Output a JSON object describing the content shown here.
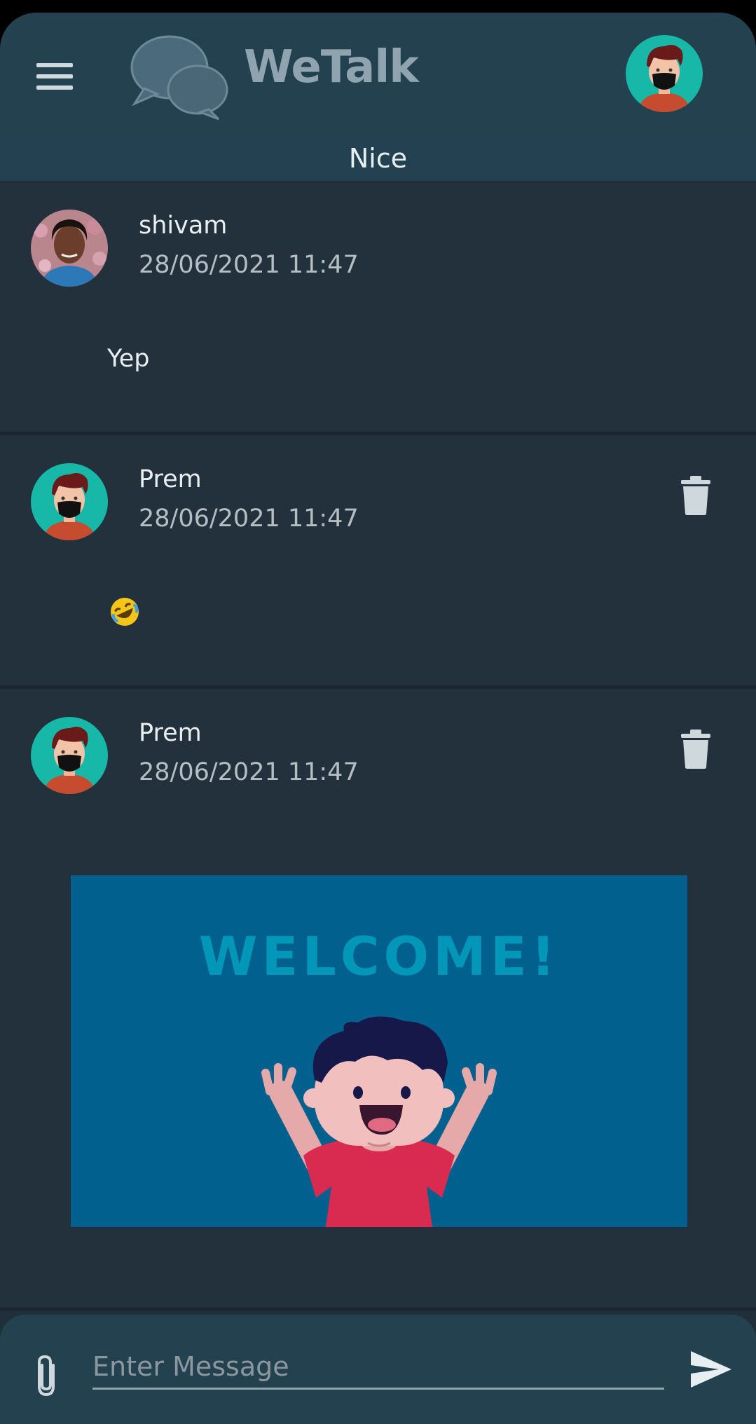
{
  "app": {
    "title": "WeTalk",
    "room_name": "Nice"
  },
  "icons": {
    "menu": "menu-icon",
    "logo": "chat-bubbles-icon",
    "delete": "trash-icon",
    "attach": "paperclip-icon",
    "send": "send-icon"
  },
  "messages": [
    {
      "sender": "shivam",
      "time": "28/06/2021 11:47",
      "text": "Yep",
      "avatar": "photo-avatar",
      "deletable": false
    },
    {
      "sender": "Prem",
      "time": "28/06/2021 11:47",
      "emoji": "laughing-emoji",
      "avatar": "masked-avatar",
      "deletable": true
    },
    {
      "sender": "Prem",
      "time": "28/06/2021 11:47",
      "image_text": "WELCOME!",
      "avatar": "masked-avatar",
      "deletable": true
    }
  ],
  "composer": {
    "placeholder": "Enter Message",
    "value": ""
  },
  "colors": {
    "appbar": "#23414e",
    "background": "#212f3a",
    "card": "#23313c",
    "avatar_teal": "#17b8a8",
    "image_bg": "#02608e"
  }
}
